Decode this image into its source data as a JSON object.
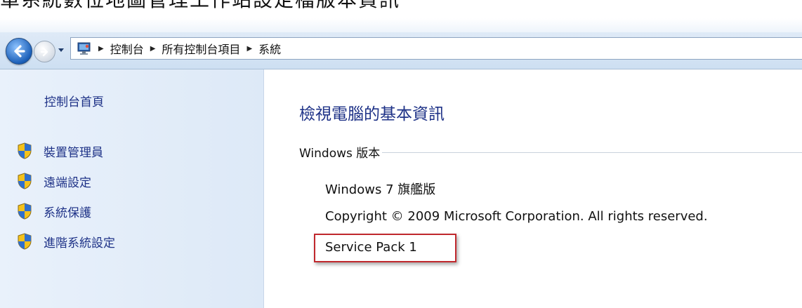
{
  "caption": "單系統數位地圖管理工作站設定檔版本資訊",
  "address_bar": {
    "crumbs": [
      "控制台",
      "所有控制台項目",
      "系統"
    ]
  },
  "sidebar": {
    "home_label": "控制台首頁",
    "items": [
      {
        "label": "裝置管理員",
        "icon": "uac-shield-icon"
      },
      {
        "label": "遠端設定",
        "icon": "uac-shield-icon"
      },
      {
        "label": "系統保護",
        "icon": "uac-shield-icon"
      },
      {
        "label": "進階系統設定",
        "icon": "uac-shield-icon"
      }
    ]
  },
  "main": {
    "title": "檢視電腦的基本資訊",
    "section_label": "Windows 版本",
    "edition": "Windows 7 旗艦版",
    "copyright": "Copyright © 2009 Microsoft Corporation.  All rights reserved.",
    "service_pack": "Service Pack 1"
  },
  "colors": {
    "link": "#1e3287",
    "highlight_border": "#c0282d",
    "sidebar_bg": "#e4eef9"
  }
}
